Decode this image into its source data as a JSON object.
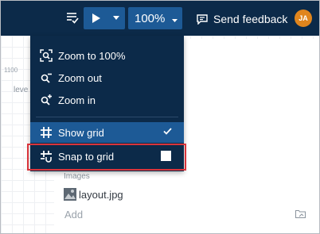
{
  "toolbar": {
    "zoom_value": "100%",
    "feedback_label": "Send feedback",
    "avatar_initials": "JA",
    "bg_color": "#0c2a49",
    "accent_color": "#1d5a96"
  },
  "canvas": {
    "ruler_value": "1100",
    "side_label": "leve"
  },
  "menu": {
    "items": [
      {
        "label": "Zoom to 100%",
        "icon": "zoom-reset-icon"
      },
      {
        "label": "Zoom out",
        "icon": "zoom-out-icon"
      },
      {
        "label": "Zoom in",
        "icon": "zoom-in-icon"
      },
      {
        "label": "Show grid",
        "icon": "grid-icon",
        "checked": true
      },
      {
        "label": "Snap to grid",
        "icon": "snap-grid-icon",
        "checked": false
      }
    ]
  },
  "images": {
    "title": "Images",
    "file_name": "layout.jpg",
    "add_label": "Add"
  },
  "highlight_color": "#d9343b"
}
